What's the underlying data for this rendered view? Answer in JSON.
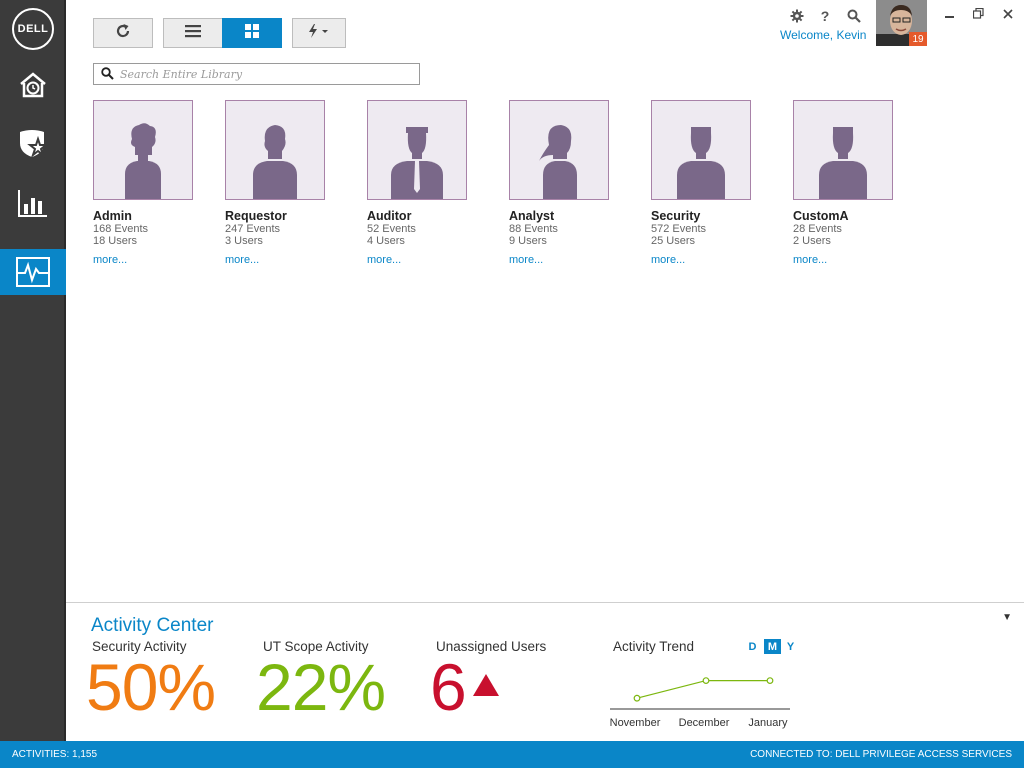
{
  "brand": {
    "logo_text": "DELL"
  },
  "leftnav": {
    "items": [
      {
        "icon": "home-clock-icon"
      },
      {
        "icon": "shield-star-icon"
      },
      {
        "icon": "bar-chart-icon"
      },
      {
        "icon": "activity-pulse-icon",
        "active": true
      }
    ]
  },
  "toolbar": {
    "refresh_icon": "refresh-icon",
    "list_icon": "list-view-icon",
    "grid_icon": "grid-view-icon",
    "actions_icon": "lightning-dropdown-icon"
  },
  "search": {
    "placeholder": "Search Entire Library",
    "value": ""
  },
  "header": {
    "welcome": "Welcome, Kevin",
    "notification_count": "19"
  },
  "roles": [
    {
      "name": "Admin",
      "events": "168 Events",
      "users": "18 Users",
      "more": "more..."
    },
    {
      "name": "Requestor",
      "events": "247 Events",
      "users": "3 Users",
      "more": "more..."
    },
    {
      "name": "Auditor",
      "events": "52 Events",
      "users": "4 Users",
      "more": "more..."
    },
    {
      "name": "Analyst",
      "events": "88 Events",
      "users": "9 Users",
      "more": "more..."
    },
    {
      "name": "Security",
      "events": "572 Events",
      "users": "25 Users",
      "more": "more..."
    },
    {
      "name": "CustomA",
      "events": "28 Events",
      "users": "2 Users",
      "more": "more..."
    }
  ],
  "activity_center": {
    "title": "Activity Center",
    "security": {
      "label": "Security Activity",
      "value": "50%",
      "color": "#f07c13"
    },
    "ut_scope": {
      "label": "UT Scope Activity",
      "value": "22%",
      "color": "#7cb70f"
    },
    "unassigned": {
      "label": "Unassigned Users",
      "value": "6",
      "color": "#c8102e"
    },
    "trend": {
      "label": "Activity Trend",
      "toggles": [
        "D",
        "M",
        "Y"
      ],
      "active_toggle": "M",
      "months": [
        "November",
        "December",
        "January"
      ]
    }
  },
  "chart_data": {
    "type": "line",
    "categories": [
      "November",
      "December",
      "January"
    ],
    "values": [
      1,
      3,
      3
    ],
    "ylim": [
      0,
      10
    ],
    "grid": false
  },
  "statusbar": {
    "activities": "ACTIVITIES:  1,155",
    "connection": "CONNECTED TO: DELL PRIVILEGE ACCESS SERVICES"
  },
  "colors": {
    "accent": "#0a86c8",
    "nav_bg": "#3b3b3b",
    "tile_border": "#a882a8",
    "tile_bg": "#eeeaf1",
    "figure": "#7a6889"
  }
}
